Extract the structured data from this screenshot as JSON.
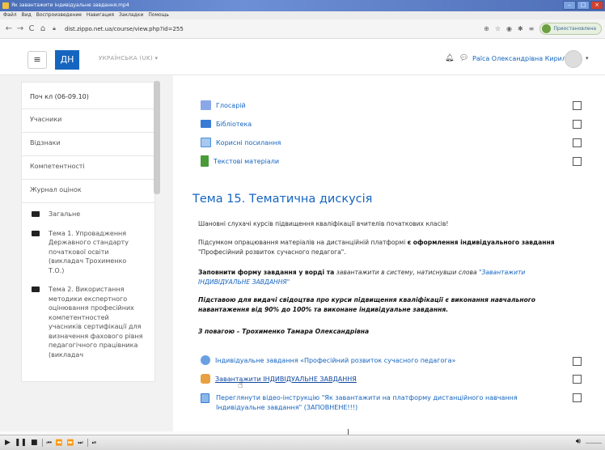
{
  "window": {
    "title": "Як завантажити індивідуальне завдання.mp4"
  },
  "menubar": [
    "Файл",
    "Вид",
    "Воспроизведение",
    "Навигация",
    "Закладки",
    "Помощь"
  ],
  "browser": {
    "url": "dist.zippo.net.ua/course/view.php?id=255",
    "paused_label": "Приостановлена"
  },
  "navbar": {
    "brand": "ДН",
    "language": "УКРАЇНСЬКА (UK) ▾",
    "user_name": "Раїса Олександрівна Кирилюк"
  },
  "drawer": {
    "items": [
      "Поч кл (06-09.10)",
      "Учасники",
      "Відзнаки",
      "Компетентності",
      "Журнал оцінок"
    ],
    "sections": [
      "Загальне",
      "Тема 1. Упровадження Державного стандарту початкової освіти (викладач Трохименко Т.О.)",
      "Тема 2. Використання методики експертного оцінювання професійних компетентностей учасників сертифікації для визначення фахового рівня педагогічного працівника (викладач"
    ]
  },
  "resources_top": [
    {
      "label": "Глосарій",
      "icon": "glossary-icon",
      "color": "#5b8ad6"
    },
    {
      "label": "Бібліотека",
      "icon": "folder-icon",
      "color": "#3a7bd5"
    },
    {
      "label": "Корисні посилання",
      "icon": "link-page-icon",
      "color": "#4a90d9"
    },
    {
      "label": "Текстові матеріали",
      "icon": "book-icon",
      "color": "#4a9a3a"
    }
  ],
  "topic": {
    "title": "Тема 15. Тематична дискусія",
    "p1": "Шановні слухачі курсів підвищення кваліфікації вчителів початкових класів!",
    "p2_a": "Підсумком опрацювання матеріалів на дистанційній платформі",
    "p2_b": "є  оформлення індивідуального завдання",
    "p2_c": "\"Професійний розвиток сучасного педагога\".",
    "p3_a": "Заповнити форму завдання у ворді та",
    "p3_b": "завантажити  в систему, натиснувши слова",
    "p3_c": "\"Завантажити ІНДИВІДУАЛЬНЕ ЗАВДАННЯ\"",
    "p4": "Підставою для видачі свідоцтва про курси підвищення кваліфікації є виконання навчального навантаження від 90% до 100% та виконане індивідуальне завдання.",
    "p5": "З повагою – Трохименко Тамара Олександрівна"
  },
  "resources_bottom": [
    {
      "label": "Індивідуальне завдання «Професійний розвиток сучасного педагога»",
      "icon": "forum-icon"
    },
    {
      "label": "Завантажити ІНДИВІДУАЛЬНЕ ЗАВДАННЯ",
      "icon": "upload-icon"
    },
    {
      "label": "Переглянути відео-інструкцію \"Як завантажити на платформу дистанційного навчання Індивідуальне завдання\" (ЗАПОВНЕНЕ!!!)",
      "icon": "page-icon"
    }
  ]
}
